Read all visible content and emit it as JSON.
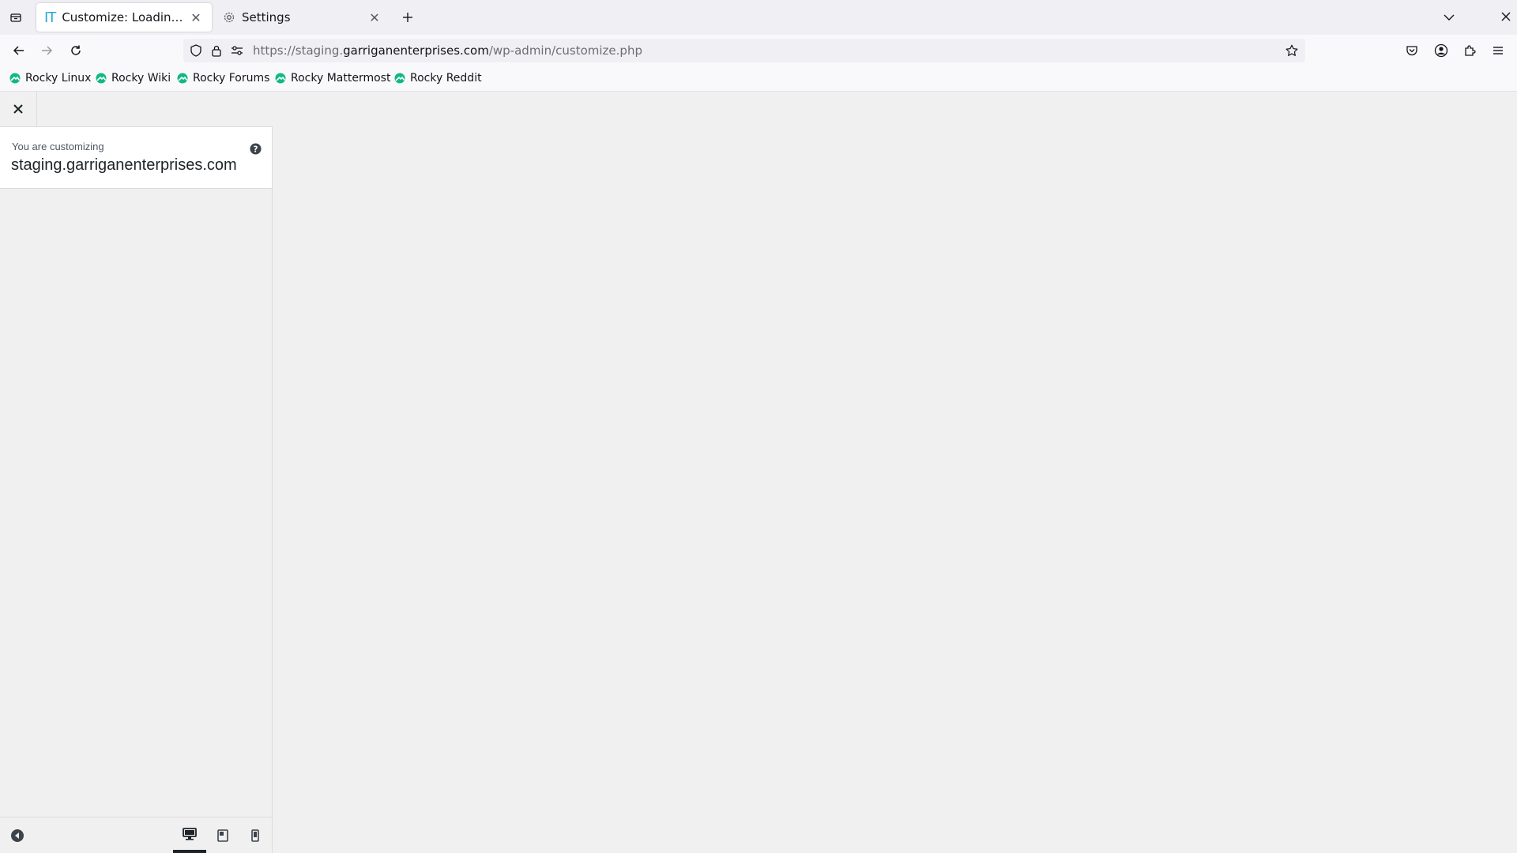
{
  "browser": {
    "tabs": [
      {
        "title": "Customize: Loading…",
        "favicon": "IT",
        "active": true
      },
      {
        "title": "Settings",
        "favicon": "gear-icon",
        "active": false
      }
    ],
    "url": {
      "prefix": "https://staging.",
      "host": "garriganenterprises.com",
      "path": "/wp-admin/customize.php"
    },
    "bookmarks": [
      "Rocky Linux",
      "Rocky Wiki",
      "Rocky Forums",
      "Rocky Mattermost",
      "Rocky Reddit"
    ]
  },
  "customizer": {
    "action_label": "You are customizing",
    "site_name": "staging.garriganenterprises.com",
    "devices": [
      "desktop",
      "tablet",
      "mobile"
    ],
    "active_device": "desktop"
  },
  "colors": {
    "bookmark_icon": "#10b981",
    "it_favicon": "#2aa6d8"
  }
}
